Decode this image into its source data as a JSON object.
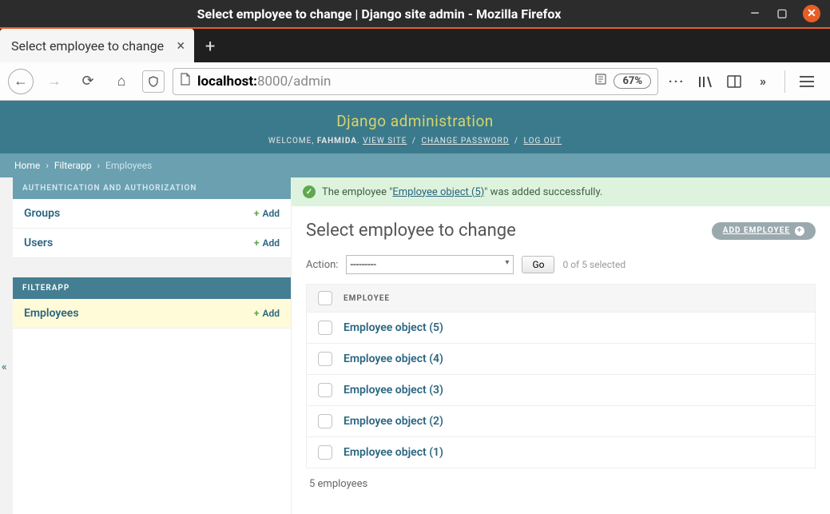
{
  "os": {
    "window_title": "Select employee to change | Django site admin - Mozilla Firefox"
  },
  "browser": {
    "tab_title": "Select employee to change",
    "url_host": "localhost:",
    "url_port_path": "8000/admin",
    "zoom": "67%"
  },
  "header": {
    "site_title": "Django administration",
    "welcome": "WELCOME,",
    "username": "FAHMIDA",
    "view_site": "VIEW SITE",
    "change_password": "CHANGE PASSWORD",
    "log_out": "LOG OUT"
  },
  "breadcrumbs": {
    "home": "Home",
    "app": "Filterapp",
    "current": "Employees"
  },
  "sidebar": {
    "auth_caption": "AUTHENTICATION AND AUTHORIZATION",
    "auth": [
      {
        "label": "Groups",
        "add": "Add"
      },
      {
        "label": "Users",
        "add": "Add"
      }
    ],
    "app_caption": "FILTERAPP",
    "app": [
      {
        "label": "Employees",
        "add": "Add"
      }
    ],
    "toggle": "«"
  },
  "message": {
    "prefix": "The employee \"",
    "object": "Employee object (5)",
    "suffix": "\" was added successfully."
  },
  "main": {
    "title": "Select employee to change",
    "add_button": "ADD EMPLOYEE",
    "action_label": "Action:",
    "action_selected": "---------",
    "go": "Go",
    "selection_count": "0 of 5 selected",
    "column_header": "EMPLOYEE",
    "rows": [
      "Employee object (5)",
      "Employee object (4)",
      "Employee object (3)",
      "Employee object (2)",
      "Employee object (1)"
    ],
    "paginator": "5 employees"
  }
}
